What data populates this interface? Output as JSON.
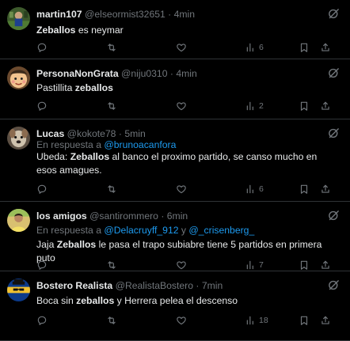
{
  "tweets": [
    {
      "name": "martin107",
      "handle": "@elseormist32651",
      "sep": "·",
      "time": "4min",
      "reply_prefix": "",
      "reply_links": [],
      "text_segments": [
        {
          "t": "Zeballos",
          "b": true
        },
        {
          "t": " es neymar",
          "b": false
        }
      ],
      "views": "6",
      "avatar_icon": "avatar-soccer-photo"
    },
    {
      "name": "PersonaNonGrata",
      "handle": "@niju0310",
      "sep": "·",
      "time": "4min",
      "reply_prefix": "",
      "reply_links": [],
      "text_segments": [
        {
          "t": "Pastillita ",
          "b": false
        },
        {
          "t": "zeballos",
          "b": true
        }
      ],
      "views": "2",
      "avatar_icon": "avatar-cartoon-face"
    },
    {
      "name": "Lucas",
      "handle": "@kokote78",
      "sep": "·",
      "time": "5min",
      "reply_prefix": "En respuesta a",
      "reply_links": [
        "@brunoacanfora"
      ],
      "reply_joiner": "",
      "text_segments": [
        {
          "t": "Ubeda: ",
          "b": false
        },
        {
          "t": "Zeballos",
          "b": true
        },
        {
          "t": " al banco el proximo partido, se canso mucho en esos amagues.",
          "b": false
        }
      ],
      "views": "6",
      "avatar_icon": "avatar-dog-photo"
    },
    {
      "name": "los amigos",
      "handle": "@santirommero",
      "sep": "·",
      "time": "6min",
      "reply_prefix": "En respuesta a",
      "reply_links": [
        "@Delacruyff_912",
        "@_crisenberg_"
      ],
      "reply_joiner": "y",
      "text_segments": [
        {
          "t": "Jaja ",
          "b": false
        },
        {
          "t": "Zeballos",
          "b": true
        },
        {
          "t": " le pasa el trapo subiabre tiene 5 partidos en primera puto",
          "b": false
        }
      ],
      "views": "7",
      "avatar_icon": "avatar-player-photo"
    },
    {
      "name": "Bostero Realista",
      "handle": "@RealistaBostero",
      "sep": "·",
      "time": "7min",
      "reply_prefix": "",
      "reply_links": [],
      "text_segments": [
        {
          "t": "Boca sin ",
          "b": false
        },
        {
          "t": "zeballos",
          "b": true
        },
        {
          "t": " y Herrera pelea el descenso",
          "b": false
        }
      ],
      "views": "18",
      "avatar_icon": "avatar-boca-meme"
    }
  ],
  "colors": {
    "background": "#000000",
    "text": "#e7e9ea",
    "muted": "#71767b",
    "link": "#1d9bf0",
    "divider": "#2f3336"
  }
}
